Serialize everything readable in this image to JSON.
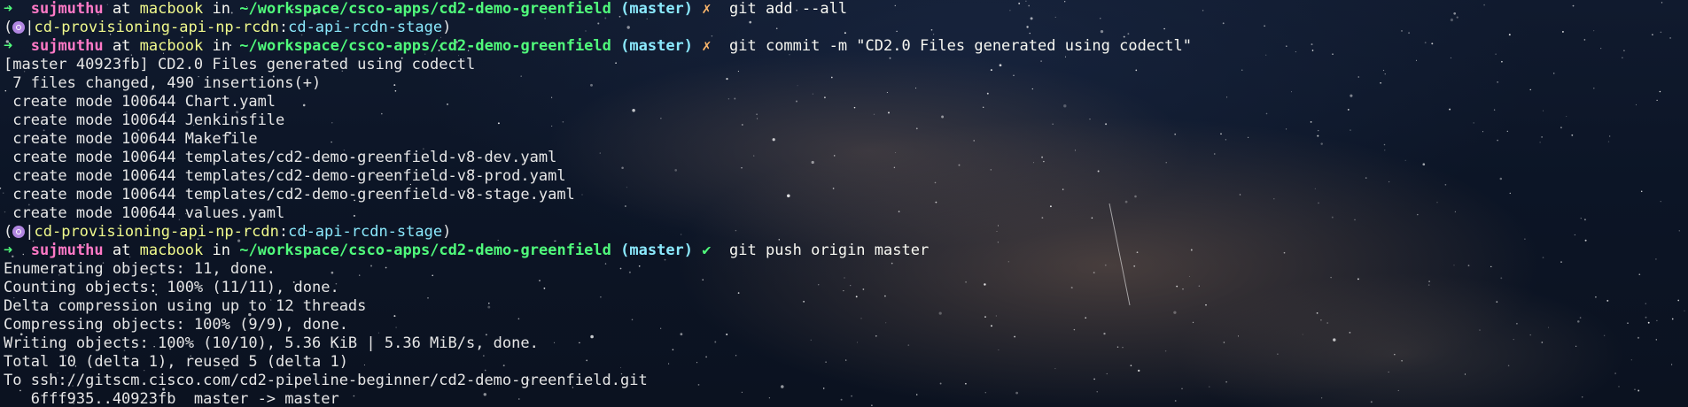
{
  "prompt": {
    "arrow": "➜",
    "user": "sujmuthu",
    "at": "at",
    "host": "macbook",
    "in": "in",
    "path": "~/workspace/csco-apps/cd2-demo-greenfield",
    "branch": "(master)",
    "dirty_mark": "✗",
    "clean_mark": "✔"
  },
  "kube": {
    "open": "(",
    "sep1": "|",
    "context": "cd-provisioning-api-np-rcdn",
    "sep2": ":",
    "namespace": "cd-api-rcdn-stage",
    "close": ")"
  },
  "commands": {
    "add": "git add --all",
    "commit": "git commit -m \"CD2.0 Files generated using codectl\"",
    "push": "git push origin master"
  },
  "commit_output": [
    "[master 40923fb] CD2.0 Files generated using codectl",
    " 7 files changed, 490 insertions(+)",
    " create mode 100644 Chart.yaml",
    " create mode 100644 Jenkinsfile",
    " create mode 100644 Makefile",
    " create mode 100644 templates/cd2-demo-greenfield-v8-dev.yaml",
    " create mode 100644 templates/cd2-demo-greenfield-v8-prod.yaml",
    " create mode 100644 templates/cd2-demo-greenfield-v8-stage.yaml",
    " create mode 100644 values.yaml"
  ],
  "push_output": [
    "Enumerating objects: 11, done.",
    "Counting objects: 100% (11/11), done.",
    "Delta compression using up to 12 threads",
    "Compressing objects: 100% (9/9), done.",
    "Writing objects: 100% (10/10), 5.36 KiB | 5.36 MiB/s, done.",
    "Total 10 (delta 1), reused 5 (delta 1)",
    "To ssh://gitscm.cisco.com/cd2-pipeline-beginner/cd2-demo-greenfield.git",
    "   6fff935..40923fb  master -> master"
  ],
  "colors": {
    "arrow": "#50fa7b",
    "user": "#ff79c6",
    "host": "#f1fa8c",
    "path": "#50fa7b",
    "branch": "#8be9fd",
    "dirty": "#ffb86c",
    "kube_icon": "#b186e0"
  },
  "icons": {
    "kube_context": "kubernetes-icon"
  }
}
